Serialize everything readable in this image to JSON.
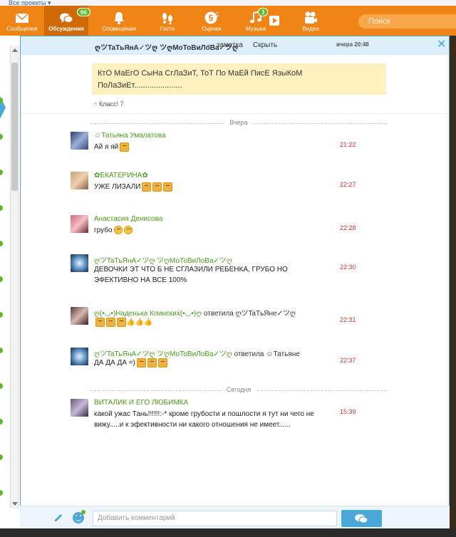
{
  "topbar": {
    "text": "Все проекты ▾"
  },
  "nav": {
    "items": [
      {
        "label": "Сообщения",
        "icon": "envelope-icon"
      },
      {
        "label": "Обсуждения",
        "icon": "chat-bubbles-icon",
        "badge": "66"
      },
      {
        "label": "Оповещения",
        "icon": "bell-icon"
      },
      {
        "label": "Гости",
        "icon": "footprints-icon"
      },
      {
        "label": "Оценки",
        "icon": "rating-5-icon"
      },
      {
        "label": "Музыка",
        "icon": "music-note-icon",
        "badge": "3"
      },
      {
        "label": "Видео",
        "icon": "film-camera-icon"
      }
    ],
    "search_placeholder": "Поиск"
  },
  "discussion": {
    "title": "ღツTaTьЯнА✓ツღ ツღМоТоВиЛоВа✓ツღ",
    "note_label": "— заметка",
    "hide_label": "Скрыть",
    "time": "вчера 20:48",
    "topic_text": "КтО МаЕгО СыНа СгЛаЗиТ, ТоТ По МаЕй ПисЕ ЯзыКоМ ПоЛаЗиЕт......................",
    "klass_label": "Класс! 7"
  },
  "day_separators": {
    "yesterday": "Вчера",
    "today": "Сегодня"
  },
  "messages": [
    {
      "author": "Татьяна Умалатова",
      "text": "Ай я яй",
      "time": "21:22"
    },
    {
      "author": "ЕКАТЕРИНА",
      "text": "УЖЕ ЛИЗАЛИ",
      "time": "22:27"
    },
    {
      "author": "Анастасия Денисова",
      "text": "грубо",
      "time": "22:28"
    },
    {
      "author": "ღツTaTьЯнА✓ツღ ツღМоТоВиЛоВа✓ツღ",
      "text": "ДЕВОЧКИ ЭТ ЧТО Б НЕ СГЛАЗИЛИ РЕБЕНКА, ГРУБО НО ЭФЕКТИВНО НА ВСЕ 100%",
      "time": "22:30"
    },
    {
      "author": "ღ(•◡•)Наденька Клинских(•◡•)ღ",
      "reply_word": "ответила",
      "reply_to": "ღツTaTьЯне✓ツღ",
      "text": "",
      "time": "22:31"
    },
    {
      "author": "ღツTaTьЯнА✓ツღ ツღМоТоВиЛоВа✓ツღ",
      "reply_word": "ответила",
      "reply_to": "Татьяне",
      "text": "ДА ДА ДА =)",
      "time": "22:37"
    },
    {
      "author": "ВИТАЛИК И ЕГО ЛЮБИМКА",
      "text": "какой ужас Тань!!!!!!:-* кроме грубости и пошлости я тут ни чего не вижу.....и к эфективности ни какого отношения не имеет......",
      "time": "15:39"
    }
  ],
  "footer": {
    "comment_placeholder": "Добавить комментарий"
  },
  "colors": {
    "nav_bg": "#f08414",
    "accent_blue": "#4aa8d8",
    "author_green": "#4a9a1a",
    "time_red": "#c0392b",
    "topic_bg": "#fdf2bf"
  }
}
